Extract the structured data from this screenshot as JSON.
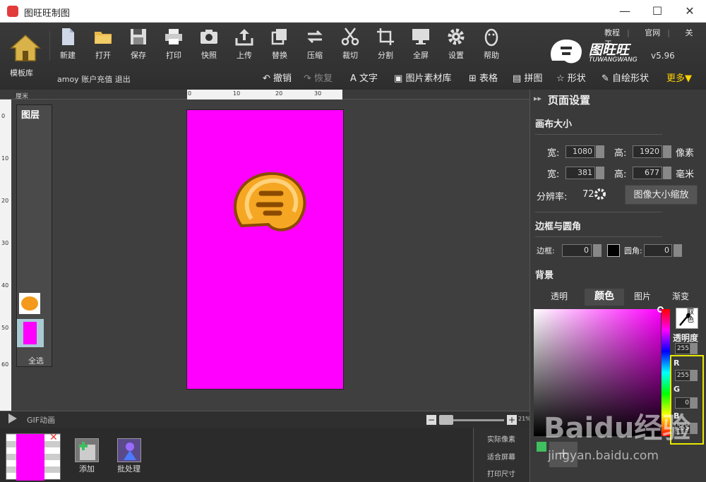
{
  "window": {
    "title": "图旺旺制图",
    "controls": [
      "—",
      "☐",
      "✕"
    ]
  },
  "toolbar": {
    "home_label": "模板库",
    "tools": [
      {
        "label": "新建",
        "icon": "new-file-icon"
      },
      {
        "label": "打开",
        "icon": "folder-open-icon"
      },
      {
        "label": "保存",
        "icon": "save-icon"
      },
      {
        "label": "打印",
        "icon": "printer-icon"
      },
      {
        "label": "快照",
        "icon": "camera-icon"
      },
      {
        "label": "上传",
        "icon": "upload-icon"
      },
      {
        "label": "替换",
        "icon": "replace-icon"
      },
      {
        "label": "压缩",
        "icon": "compress-icon"
      },
      {
        "label": "裁切",
        "icon": "scissors-icon"
      },
      {
        "label": "分割",
        "icon": "crop-icon"
      },
      {
        "label": "全屏",
        "icon": "monitor-icon"
      },
      {
        "label": "设置",
        "icon": "gear-icon"
      },
      {
        "label": "帮助",
        "icon": "qq-penguin-icon"
      }
    ],
    "account": "amoy 账户充值 退出",
    "top_links": [
      "教程",
      "官网",
      "关于"
    ],
    "brand_wordmark": "图旺旺",
    "brand_sub": "TUWANGWANG",
    "version": "v5.96",
    "subtools": [
      {
        "label": "撤销",
        "icon": "undo-icon",
        "enabled": true
      },
      {
        "label": "恢复",
        "icon": "redo-icon",
        "enabled": false
      },
      {
        "label": "文字",
        "icon": "text-icon",
        "enabled": true
      },
      {
        "label": "图片素材库",
        "icon": "image-icon",
        "enabled": true
      },
      {
        "label": "表格",
        "icon": "table-icon",
        "enabled": true
      },
      {
        "label": "拼图",
        "icon": "collage-icon",
        "enabled": true
      },
      {
        "label": "形状",
        "icon": "star-shape-icon",
        "enabled": true
      },
      {
        "label": "自绘形状",
        "icon": "pen-icon",
        "enabled": true
      }
    ],
    "more": "更多▼"
  },
  "canvas": {
    "ruler_unit": "厘米",
    "ruler_top_ticks": [
      "0",
      "10",
      "20",
      "30"
    ],
    "ruler_left_ticks": [
      "0",
      "10",
      "20",
      "30",
      "40",
      "50",
      "60"
    ],
    "layers_title": "图层",
    "select_all": "全选",
    "page_color": "#ff00ff"
  },
  "gif": {
    "label": "GIF动画",
    "zoom_value": "21%",
    "add_label": "添加",
    "batch_label": "批处理",
    "view_options": [
      "实际像素",
      "适合屏幕",
      "打印尺寸"
    ]
  },
  "page_settings": {
    "header": "页面设置",
    "canvas_size_title": "画布大小",
    "width_label": "宽:",
    "height_label": "高:",
    "width_px": "1080",
    "height_px": "1920",
    "px_unit": "像素",
    "width_mm": "381",
    "height_mm": "677",
    "mm_unit": "毫米",
    "dpi_label": "分辨率:",
    "dpi_value": "72",
    "resize_button": "图像大小缩放",
    "border_title": "边框与圆角",
    "border_label": "边框:",
    "border_value": "0",
    "radius_label": "圆角:",
    "radius_value": "0",
    "background_title": "背景",
    "bg_tabs": [
      "透明",
      "颜色",
      "图片",
      "渐变"
    ],
    "eyedropper_label": "取色",
    "opacity_label": "透明度",
    "opacity_value": "255",
    "r_label": "R",
    "r_value": "255",
    "g_label": "G",
    "g_value": "0",
    "b_label": "B",
    "b_value": "255"
  },
  "watermark": {
    "baidu": "Baidu经验",
    "url": "jingyan.baidu.com"
  },
  "colors": {
    "canvas_background": "#ff00ff",
    "highlight_box": "#e8e800",
    "more_link": "#ffd200"
  }
}
